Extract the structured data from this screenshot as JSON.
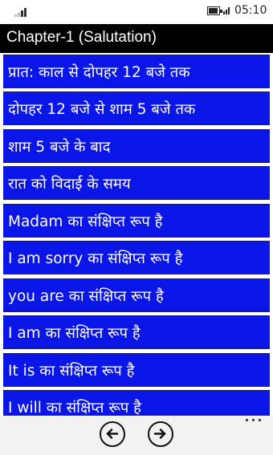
{
  "status_bar": {
    "time": "05:10",
    "icons": [
      "signal-strength-icon",
      "battery-icon",
      "wifi-icon"
    ]
  },
  "header": {
    "title": "Chapter-1 (Salutation)",
    "background": "#000000"
  },
  "list": {
    "item_background": "#0a15e8",
    "items": [
      {
        "label": "प्रात: काल से दोपहर 12 बजे तक"
      },
      {
        "label": "दोपहर 12 बजे से शाम 5 बजे तक"
      },
      {
        "label": "शाम 5 बजे के बाद"
      },
      {
        "label": "रात को विदाई के समय"
      },
      {
        "label": "Madam का संक्षिप्त रूप है"
      },
      {
        "label": "I am sorry का संक्षिप्त रूप है"
      },
      {
        "label": "you are का संक्षिप्त रूप है"
      },
      {
        "label": "I am का संक्षिप्त रूप है"
      },
      {
        "label": "It is का संक्षिप्त रूप है"
      },
      {
        "label": "I will का संक्षिप्त रूप है"
      }
    ]
  },
  "app_bar": {
    "buttons": [
      "back-arrow-icon",
      "forward-arrow-icon",
      "more-options-icon"
    ]
  }
}
